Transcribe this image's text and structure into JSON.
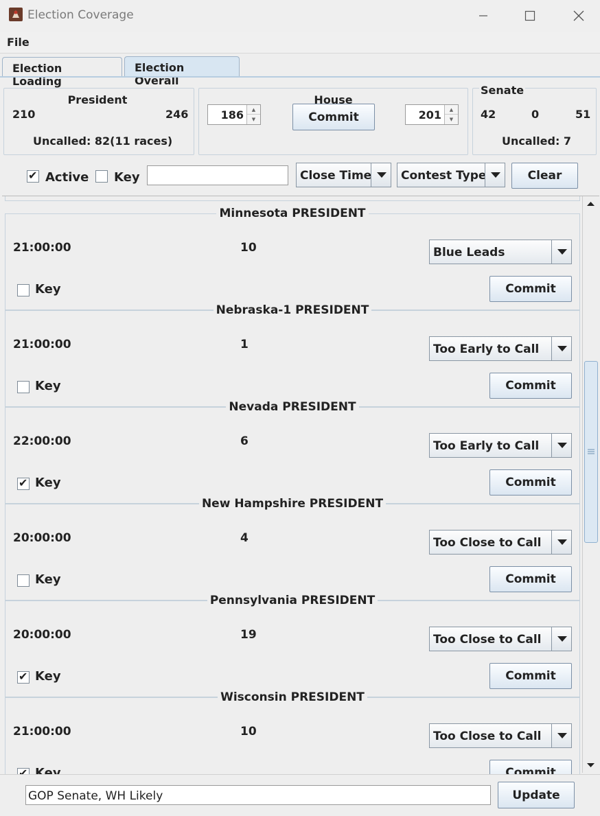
{
  "window": {
    "title": "Election Coverage",
    "icon": "app-java-icon"
  },
  "menu": {
    "file": "File"
  },
  "tabs": [
    {
      "label": "Election Loading",
      "selected": false
    },
    {
      "label": "Election Overall",
      "selected": true
    }
  ],
  "president": {
    "title": "President",
    "left": "210",
    "right": "246",
    "uncalled": "Uncalled: 82(11 races)"
  },
  "house": {
    "title": "House",
    "left_value": "186",
    "right_value": "201",
    "commit": "Commit"
  },
  "senate": {
    "title": "Senate",
    "left": "42",
    "middle": "0",
    "right": "51",
    "uncalled": "Uncalled: 7"
  },
  "filters": {
    "active_label": "Active",
    "active_checked": true,
    "key_label": "Key",
    "key_checked": false,
    "search_value": "",
    "close_time": "Close Time",
    "contest_type": "Contest Type",
    "clear": "Clear"
  },
  "races": [
    {
      "title": "Minnesota PRESIDENT",
      "time": "21:00:00",
      "ev": "10",
      "status": "Blue Leads",
      "key_label": "Key",
      "key": false,
      "commit": "Commit"
    },
    {
      "title": "Nebraska-1 PRESIDENT",
      "time": "21:00:00",
      "ev": "1",
      "status": "Too Early to Call",
      "key_label": "Key",
      "key": false,
      "commit": "Commit"
    },
    {
      "title": "Nevada PRESIDENT",
      "time": "22:00:00",
      "ev": "6",
      "status": "Too Early to Call",
      "key_label": "Key",
      "key": true,
      "commit": "Commit"
    },
    {
      "title": "New Hampshire PRESIDENT",
      "time": "20:00:00",
      "ev": "4",
      "status": "Too Close to Call",
      "key_label": "Key",
      "key": false,
      "commit": "Commit"
    },
    {
      "title": "Pennsylvania PRESIDENT",
      "time": "20:00:00",
      "ev": "19",
      "status": "Too Close to Call",
      "key_label": "Key",
      "key": true,
      "commit": "Commit"
    },
    {
      "title": "Wisconsin PRESIDENT",
      "time": "21:00:00",
      "ev": "10",
      "status": "Too Close to Call",
      "key_label": "Key",
      "key": true,
      "commit": "Commit"
    }
  ],
  "bottom": {
    "headline": "GOP Senate, WH Likely",
    "update": "Update"
  },
  "colors": {
    "tab_selected": "#d8e6f2",
    "button_border": "#7b8fa6",
    "panel_border": "#c6d2dc"
  }
}
